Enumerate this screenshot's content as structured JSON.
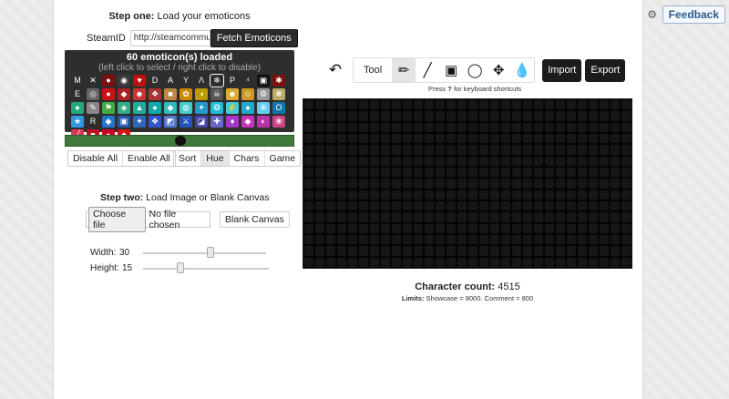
{
  "header": {
    "social_icons": [
      "twitter-icon",
      "steam-icon"
    ],
    "feedback_label": "Feedback"
  },
  "step1": {
    "title_bold": "Step one:",
    "title_rest": "Load your emoticons",
    "steamid_label": "SteamID",
    "steamid_value": "http://steamcommunity",
    "fetch_label": "Fetch Emoticons"
  },
  "emoticons": {
    "count_text": "60 emoticon(s) loaded",
    "hint_text": "(left click to select / right click to disable)",
    "selected_index": 9,
    "items": [
      {
        "glyph": "M",
        "color": "#2e2e2e"
      },
      {
        "glyph": "✕",
        "color": "#2e2e2e"
      },
      {
        "glyph": "●",
        "color": "#7a1010"
      },
      {
        "glyph": "◉",
        "color": "#3a3a3a"
      },
      {
        "glyph": "♥",
        "color": "#b11"
      },
      {
        "glyph": "D",
        "color": "#2e2e2e"
      },
      {
        "glyph": "A",
        "color": "#2e2e2e"
      },
      {
        "glyph": "Y",
        "color": "#2e2e2e"
      },
      {
        "glyph": "Λ",
        "color": "#2e2e2e"
      },
      {
        "glyph": "❄",
        "color": "#2e2e2e"
      },
      {
        "glyph": "P",
        "color": "#2e2e2e"
      },
      {
        "glyph": "⁴",
        "color": "#2e2e2e"
      },
      {
        "glyph": "▣",
        "color": "#111"
      },
      {
        "glyph": "✱",
        "color": "#7a1010"
      },
      {
        "glyph": "E",
        "color": "#2e2e2e"
      },
      {
        "glyph": "◎",
        "color": "#666"
      },
      {
        "glyph": "●",
        "color": "#c11"
      },
      {
        "glyph": "◆",
        "color": "#a22"
      },
      {
        "glyph": "☻",
        "color": "#c33"
      },
      {
        "glyph": "❖",
        "color": "#a33"
      },
      {
        "glyph": "■",
        "color": "#b84"
      },
      {
        "glyph": "✿",
        "color": "#c80"
      },
      {
        "glyph": "◑",
        "color": "#b90"
      },
      {
        "glyph": "☠",
        "color": "#555"
      },
      {
        "glyph": "☻",
        "color": "#da3"
      },
      {
        "glyph": "☺",
        "color": "#c92"
      },
      {
        "glyph": "⚙",
        "color": "#999"
      },
      {
        "glyph": "❋",
        "color": "#ba6"
      },
      {
        "glyph": "●",
        "color": "#2a7"
      },
      {
        "glyph": "✎",
        "color": "#888"
      },
      {
        "glyph": "⚑",
        "color": "#4a4"
      },
      {
        "glyph": "◈",
        "color": "#3a8"
      },
      {
        "glyph": "▲",
        "color": "#2a9"
      },
      {
        "glyph": "●",
        "color": "#1aa"
      },
      {
        "glyph": "◆",
        "color": "#3bb"
      },
      {
        "glyph": "◍",
        "color": "#4cc"
      },
      {
        "glyph": "✦",
        "color": "#29c"
      },
      {
        "glyph": "❂",
        "color": "#2bd"
      },
      {
        "glyph": "⚡",
        "color": "#4cd"
      },
      {
        "glyph": "●",
        "color": "#2ac"
      },
      {
        "glyph": "❄",
        "color": "#6ce"
      },
      {
        "glyph": "O",
        "color": "#17a"
      },
      {
        "glyph": "★",
        "color": "#39d"
      },
      {
        "glyph": "R",
        "color": "#2e2e2e"
      },
      {
        "glyph": "◆",
        "color": "#27c"
      },
      {
        "glyph": "▣",
        "color": "#25a"
      },
      {
        "glyph": "✦",
        "color": "#36b"
      },
      {
        "glyph": "❖",
        "color": "#35c"
      },
      {
        "glyph": "◩",
        "color": "#57c"
      },
      {
        "glyph": "⚔",
        "color": "#25b"
      },
      {
        "glyph": "◪",
        "color": "#44a"
      },
      {
        "glyph": "✚",
        "color": "#66c"
      },
      {
        "glyph": "♦",
        "color": "#a3c"
      },
      {
        "glyph": "◆",
        "color": "#c3b"
      },
      {
        "glyph": "◐",
        "color": "#b3a"
      },
      {
        "glyph": "❀",
        "color": "#c48"
      },
      {
        "glyph": "╱",
        "color": "#d35"
      },
      {
        "glyph": "■",
        "color": "#b12"
      },
      {
        "glyph": "●",
        "color": "#c02"
      },
      {
        "glyph": "◆",
        "color": "#d11"
      }
    ],
    "hue_slider": 0.5
  },
  "sort": {
    "disable_all_label": "Disable All",
    "enable_all_label": "Enable All",
    "buttons": [
      "Sort",
      "Hue",
      "Chars",
      "Game"
    ],
    "active_index": 1
  },
  "step2": {
    "title_bold": "Step two:",
    "title_rest": "Load Image or Blank Canvas",
    "choose_file_label": "Choose file",
    "no_file_text": "No file chosen",
    "blank_canvas_label": "Blank Canvas"
  },
  "dimensions": {
    "width_label": "Width:",
    "width_value": "30",
    "width_fraction": 0.55,
    "height_label": "Height:",
    "height_value": "15",
    "height_fraction": 0.3
  },
  "tools": {
    "undo_icon": "undo-arrow-icon",
    "label": "Tool",
    "items": [
      "pencil-icon",
      "line-icon",
      "rectangle-icon",
      "circle-icon",
      "move-icon",
      "fill-icon"
    ],
    "active_index": 0,
    "import_label": "Import",
    "export_label": "Export",
    "shortcut_pre": "Press",
    "shortcut_key": "?",
    "shortcut_post": "for keyboard shortcuts"
  },
  "canvas": {
    "columns": 30,
    "rows": 15
  },
  "stats": {
    "char_count_label": "Character count:",
    "char_count_value": "4515",
    "limits_label": "Limits:",
    "limits_text": "Showcase = 8000. Comment = 800"
  }
}
